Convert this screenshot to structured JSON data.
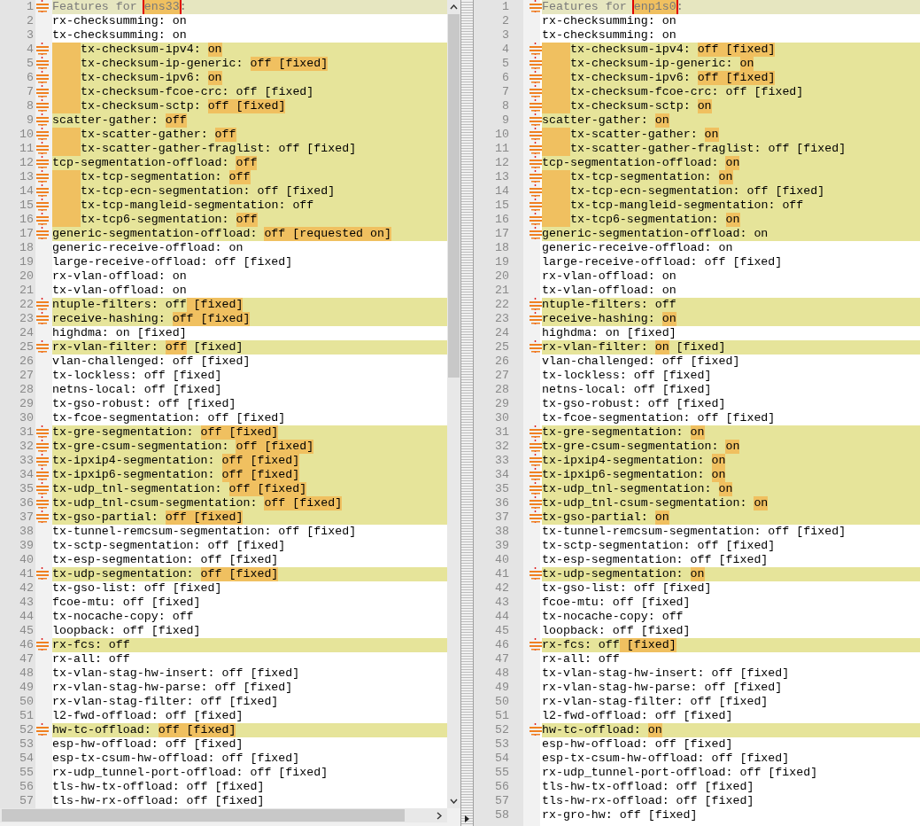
{
  "panes": [
    {
      "lines": [
        {
          "n": "1",
          "changed": true,
          "current": true,
          "indent": false,
          "parts": [
            {
              "text": "Features for ",
              "diff": false
            },
            {
              "text": "ens33",
              "diff": true,
              "boxed": true
            },
            {
              "text": ":",
              "diff": false
            }
          ]
        },
        {
          "n": "2",
          "changed": false,
          "current": false,
          "indent": false,
          "parts": [
            {
              "text": "rx-checksumming: on",
              "diff": false
            }
          ]
        },
        {
          "n": "3",
          "changed": false,
          "current": false,
          "indent": false,
          "parts": [
            {
              "text": "tx-checksumming: on",
              "diff": false
            }
          ]
        },
        {
          "n": "4",
          "changed": true,
          "current": false,
          "indent": true,
          "parts": [
            {
              "text": "tx-checksum-ipv4: ",
              "diff": false
            },
            {
              "text": "on",
              "diff": true
            }
          ]
        },
        {
          "n": "5",
          "changed": true,
          "current": false,
          "indent": true,
          "parts": [
            {
              "text": "tx-checksum-ip-generic: ",
              "diff": false
            },
            {
              "text": "off [fixed]",
              "diff": true
            }
          ]
        },
        {
          "n": "6",
          "changed": true,
          "current": false,
          "indent": true,
          "parts": [
            {
              "text": "tx-checksum-ipv6: ",
              "diff": false
            },
            {
              "text": "on",
              "diff": true
            }
          ]
        },
        {
          "n": "7",
          "changed": true,
          "current": false,
          "indent": true,
          "parts": [
            {
              "text": "tx-checksum-fcoe-crc: off [fixed]",
              "diff": false
            }
          ]
        },
        {
          "n": "8",
          "changed": true,
          "current": false,
          "indent": true,
          "parts": [
            {
              "text": "tx-checksum-sctp: ",
              "diff": false
            },
            {
              "text": "off [fixed]",
              "diff": true
            }
          ]
        },
        {
          "n": "9",
          "changed": true,
          "current": false,
          "indent": false,
          "parts": [
            {
              "text": "scatter-gather: ",
              "diff": false
            },
            {
              "text": "off",
              "diff": true
            }
          ]
        },
        {
          "n": "10",
          "changed": true,
          "current": false,
          "indent": true,
          "parts": [
            {
              "text": "tx-scatter-gather: ",
              "diff": false
            },
            {
              "text": "off",
              "diff": true
            }
          ]
        },
        {
          "n": "11",
          "changed": true,
          "current": false,
          "indent": true,
          "parts": [
            {
              "text": "tx-scatter-gather-fraglist: off [fixed]",
              "diff": false
            }
          ]
        },
        {
          "n": "12",
          "changed": true,
          "current": false,
          "indent": false,
          "parts": [
            {
              "text": "tcp-segmentation-offload: ",
              "diff": false
            },
            {
              "text": "off",
              "diff": true
            }
          ]
        },
        {
          "n": "13",
          "changed": true,
          "current": false,
          "indent": true,
          "parts": [
            {
              "text": "tx-tcp-segmentation: ",
              "diff": false
            },
            {
              "text": "off",
              "diff": true
            }
          ]
        },
        {
          "n": "14",
          "changed": true,
          "current": false,
          "indent": true,
          "parts": [
            {
              "text": "tx-tcp-ecn-segmentation: off [fixed]",
              "diff": false
            }
          ]
        },
        {
          "n": "15",
          "changed": true,
          "current": false,
          "indent": true,
          "parts": [
            {
              "text": "tx-tcp-mangleid-segmentation: off",
              "diff": false
            }
          ]
        },
        {
          "n": "16",
          "changed": true,
          "current": false,
          "indent": true,
          "parts": [
            {
              "text": "tx-tcp6-segmentation: ",
              "diff": false
            },
            {
              "text": "off",
              "diff": true
            }
          ]
        },
        {
          "n": "17",
          "changed": true,
          "current": false,
          "indent": false,
          "parts": [
            {
              "text": "generic-segmentation-offload: ",
              "diff": false
            },
            {
              "text": "off [requested on]",
              "diff": true
            }
          ]
        },
        {
          "n": "18",
          "changed": false,
          "current": false,
          "indent": false,
          "parts": [
            {
              "text": "generic-receive-offload: on",
              "diff": false
            }
          ]
        },
        {
          "n": "19",
          "changed": false,
          "current": false,
          "indent": false,
          "parts": [
            {
              "text": "large-receive-offload: off [fixed]",
              "diff": false
            }
          ]
        },
        {
          "n": "20",
          "changed": false,
          "current": false,
          "indent": false,
          "parts": [
            {
              "text": "rx-vlan-offload: on",
              "diff": false
            }
          ]
        },
        {
          "n": "21",
          "changed": false,
          "current": false,
          "indent": false,
          "parts": [
            {
              "text": "tx-vlan-offload: on",
              "diff": false
            }
          ]
        },
        {
          "n": "22",
          "changed": true,
          "current": false,
          "indent": false,
          "parts": [
            {
              "text": "ntuple-filters: off",
              "diff": false
            },
            {
              "text": " [fixed]",
              "diff": true
            }
          ]
        },
        {
          "n": "23",
          "changed": true,
          "current": false,
          "indent": false,
          "parts": [
            {
              "text": "receive-hashing: ",
              "diff": false
            },
            {
              "text": "off [fixed]",
              "diff": true
            }
          ]
        },
        {
          "n": "24",
          "changed": false,
          "current": false,
          "indent": false,
          "parts": [
            {
              "text": "highdma: on [fixed]",
              "diff": false
            }
          ]
        },
        {
          "n": "25",
          "changed": true,
          "current": false,
          "indent": false,
          "parts": [
            {
              "text": "rx-vlan-filter: ",
              "diff": false
            },
            {
              "text": "off",
              "diff": true
            },
            {
              "text": " [fixed]",
              "diff": false
            }
          ]
        },
        {
          "n": "26",
          "changed": false,
          "current": false,
          "indent": false,
          "parts": [
            {
              "text": "vlan-challenged: off [fixed]",
              "diff": false
            }
          ]
        },
        {
          "n": "27",
          "changed": false,
          "current": false,
          "indent": false,
          "parts": [
            {
              "text": "tx-lockless: off [fixed]",
              "diff": false
            }
          ]
        },
        {
          "n": "28",
          "changed": false,
          "current": false,
          "indent": false,
          "parts": [
            {
              "text": "netns-local: off [fixed]",
              "diff": false
            }
          ]
        },
        {
          "n": "29",
          "changed": false,
          "current": false,
          "indent": false,
          "parts": [
            {
              "text": "tx-gso-robust: off [fixed]",
              "diff": false
            }
          ]
        },
        {
          "n": "30",
          "changed": false,
          "current": false,
          "indent": false,
          "parts": [
            {
              "text": "tx-fcoe-segmentation: off [fixed]",
              "diff": false
            }
          ]
        },
        {
          "n": "31",
          "changed": true,
          "current": false,
          "indent": false,
          "parts": [
            {
              "text": "tx-gre-segmentation: ",
              "diff": false
            },
            {
              "text": "off [fixed]",
              "diff": true
            }
          ]
        },
        {
          "n": "32",
          "changed": true,
          "current": false,
          "indent": false,
          "parts": [
            {
              "text": "tx-gre-csum-segmentation: ",
              "diff": false
            },
            {
              "text": "off [fixed]",
              "diff": true
            }
          ]
        },
        {
          "n": "33",
          "changed": true,
          "current": false,
          "indent": false,
          "parts": [
            {
              "text": "tx-ipxip4-segmentation: ",
              "diff": false
            },
            {
              "text": "off [fixed]",
              "diff": true
            }
          ]
        },
        {
          "n": "34",
          "changed": true,
          "current": false,
          "indent": false,
          "parts": [
            {
              "text": "tx-ipxip6-segmentation: ",
              "diff": false
            },
            {
              "text": "off [fixed]",
              "diff": true
            }
          ]
        },
        {
          "n": "35",
          "changed": true,
          "current": false,
          "indent": false,
          "parts": [
            {
              "text": "tx-udp_tnl-segmentation: ",
              "diff": false
            },
            {
              "text": "off [fixed]",
              "diff": true
            }
          ]
        },
        {
          "n": "36",
          "changed": true,
          "current": false,
          "indent": false,
          "parts": [
            {
              "text": "tx-udp_tnl-csum-segmentation: ",
              "diff": false
            },
            {
              "text": "off [fixed]",
              "diff": true
            }
          ]
        },
        {
          "n": "37",
          "changed": true,
          "current": false,
          "indent": false,
          "parts": [
            {
              "text": "tx-gso-partial: ",
              "diff": false
            },
            {
              "text": "off [fixed]",
              "diff": true
            }
          ]
        },
        {
          "n": "38",
          "changed": false,
          "current": false,
          "indent": false,
          "parts": [
            {
              "text": "tx-tunnel-remcsum-segmentation: off [fixed]",
              "diff": false
            }
          ]
        },
        {
          "n": "39",
          "changed": false,
          "current": false,
          "indent": false,
          "parts": [
            {
              "text": "tx-sctp-segmentation: off [fixed]",
              "diff": false
            }
          ]
        },
        {
          "n": "40",
          "changed": false,
          "current": false,
          "indent": false,
          "parts": [
            {
              "text": "tx-esp-segmentation: off [fixed]",
              "diff": false
            }
          ]
        },
        {
          "n": "41",
          "changed": true,
          "current": false,
          "indent": false,
          "parts": [
            {
              "text": "tx-udp-segmentation: ",
              "diff": false
            },
            {
              "text": "off [fixed]",
              "diff": true
            }
          ]
        },
        {
          "n": "42",
          "changed": false,
          "current": false,
          "indent": false,
          "parts": [
            {
              "text": "tx-gso-list: off [fixed]",
              "diff": false
            }
          ]
        },
        {
          "n": "43",
          "changed": false,
          "current": false,
          "indent": false,
          "parts": [
            {
              "text": "fcoe-mtu: off [fixed]",
              "diff": false
            }
          ]
        },
        {
          "n": "44",
          "changed": false,
          "current": false,
          "indent": false,
          "parts": [
            {
              "text": "tx-nocache-copy: off",
              "diff": false
            }
          ]
        },
        {
          "n": "45",
          "changed": false,
          "current": false,
          "indent": false,
          "parts": [
            {
              "text": "loopback: off [fixed]",
              "diff": false
            }
          ]
        },
        {
          "n": "46",
          "changed": true,
          "current": false,
          "indent": false,
          "parts": [
            {
              "text": "rx-fcs: off",
              "diff": false
            }
          ]
        },
        {
          "n": "47",
          "changed": false,
          "current": false,
          "indent": false,
          "parts": [
            {
              "text": "rx-all: off",
              "diff": false
            }
          ]
        },
        {
          "n": "48",
          "changed": false,
          "current": false,
          "indent": false,
          "parts": [
            {
              "text": "tx-vlan-stag-hw-insert: off [fixed]",
              "diff": false
            }
          ]
        },
        {
          "n": "49",
          "changed": false,
          "current": false,
          "indent": false,
          "parts": [
            {
              "text": "rx-vlan-stag-hw-parse: off [fixed]",
              "diff": false
            }
          ]
        },
        {
          "n": "50",
          "changed": false,
          "current": false,
          "indent": false,
          "parts": [
            {
              "text": "rx-vlan-stag-filter: off [fixed]",
              "diff": false
            }
          ]
        },
        {
          "n": "51",
          "changed": false,
          "current": false,
          "indent": false,
          "parts": [
            {
              "text": "l2-fwd-offload: off [fixed]",
              "diff": false
            }
          ]
        },
        {
          "n": "52",
          "changed": true,
          "current": false,
          "indent": false,
          "parts": [
            {
              "text": "hw-tc-offload: ",
              "diff": false
            },
            {
              "text": "off [fixed]",
              "diff": true
            }
          ]
        },
        {
          "n": "53",
          "changed": false,
          "current": false,
          "indent": false,
          "parts": [
            {
              "text": "esp-hw-offload: off [fixed]",
              "diff": false
            }
          ]
        },
        {
          "n": "54",
          "changed": false,
          "current": false,
          "indent": false,
          "parts": [
            {
              "text": "esp-tx-csum-hw-offload: off [fixed]",
              "diff": false
            }
          ]
        },
        {
          "n": "55",
          "changed": false,
          "current": false,
          "indent": false,
          "parts": [
            {
              "text": "rx-udp_tunnel-port-offload: off [fixed]",
              "diff": false
            }
          ]
        },
        {
          "n": "56",
          "changed": false,
          "current": false,
          "indent": false,
          "parts": [
            {
              "text": "tls-hw-tx-offload: off [fixed]",
              "diff": false
            }
          ]
        },
        {
          "n": "57",
          "changed": false,
          "current": false,
          "indent": false,
          "parts": [
            {
              "text": "tls-hw-rx-offload: off [fixed]",
              "diff": false
            }
          ]
        }
      ]
    },
    {
      "lines": [
        {
          "n": "1",
          "changed": true,
          "current": true,
          "indent": false,
          "parts": [
            {
              "text": "Features for ",
              "diff": false
            },
            {
              "text": "enp1s0",
              "diff": true,
              "boxed": true
            },
            {
              "text": ":",
              "diff": false
            }
          ]
        },
        {
          "n": "2",
          "changed": false,
          "current": false,
          "indent": false,
          "parts": [
            {
              "text": "rx-checksumming: on",
              "diff": false
            }
          ]
        },
        {
          "n": "3",
          "changed": false,
          "current": false,
          "indent": false,
          "parts": [
            {
              "text": "tx-checksumming: on",
              "diff": false
            }
          ]
        },
        {
          "n": "4",
          "changed": true,
          "current": false,
          "indent": true,
          "parts": [
            {
              "text": "tx-checksum-ipv4: ",
              "diff": false
            },
            {
              "text": "off [fixed]",
              "diff": true
            }
          ]
        },
        {
          "n": "5",
          "changed": true,
          "current": false,
          "indent": true,
          "parts": [
            {
              "text": "tx-checksum-ip-generic: ",
              "diff": false
            },
            {
              "text": "on",
              "diff": true
            }
          ]
        },
        {
          "n": "6",
          "changed": true,
          "current": false,
          "indent": true,
          "parts": [
            {
              "text": "tx-checksum-ipv6: ",
              "diff": false
            },
            {
              "text": "off [fixed]",
              "diff": true
            }
          ]
        },
        {
          "n": "7",
          "changed": true,
          "current": false,
          "indent": true,
          "parts": [
            {
              "text": "tx-checksum-fcoe-crc: off [fixed]",
              "diff": false
            }
          ]
        },
        {
          "n": "8",
          "changed": true,
          "current": false,
          "indent": true,
          "parts": [
            {
              "text": "tx-checksum-sctp: ",
              "diff": false
            },
            {
              "text": "on",
              "diff": true
            }
          ]
        },
        {
          "n": "9",
          "changed": true,
          "current": false,
          "indent": false,
          "parts": [
            {
              "text": "scatter-gather: ",
              "diff": false
            },
            {
              "text": "on",
              "diff": true
            }
          ]
        },
        {
          "n": "10",
          "changed": true,
          "current": false,
          "indent": true,
          "parts": [
            {
              "text": "tx-scatter-gather: ",
              "diff": false
            },
            {
              "text": "on",
              "diff": true
            }
          ]
        },
        {
          "n": "11",
          "changed": true,
          "current": false,
          "indent": true,
          "parts": [
            {
              "text": "tx-scatter-gather-fraglist: off [fixed]",
              "diff": false
            }
          ]
        },
        {
          "n": "12",
          "changed": true,
          "current": false,
          "indent": false,
          "parts": [
            {
              "text": "tcp-segmentation-offload: ",
              "diff": false
            },
            {
              "text": "on",
              "diff": true
            }
          ]
        },
        {
          "n": "13",
          "changed": true,
          "current": false,
          "indent": true,
          "parts": [
            {
              "text": "tx-tcp-segmentation: ",
              "diff": false
            },
            {
              "text": "on",
              "diff": true
            }
          ]
        },
        {
          "n": "14",
          "changed": true,
          "current": false,
          "indent": true,
          "parts": [
            {
              "text": "tx-tcp-ecn-segmentation: off [fixed]",
              "diff": false
            }
          ]
        },
        {
          "n": "15",
          "changed": true,
          "current": false,
          "indent": true,
          "parts": [
            {
              "text": "tx-tcp-mangleid-segmentation: off",
              "diff": false
            }
          ]
        },
        {
          "n": "16",
          "changed": true,
          "current": false,
          "indent": true,
          "parts": [
            {
              "text": "tx-tcp6-segmentation: ",
              "diff": false
            },
            {
              "text": "on",
              "diff": true
            }
          ]
        },
        {
          "n": "17",
          "changed": true,
          "current": false,
          "indent": false,
          "parts": [
            {
              "text": "generic-segmentation-offload: on",
              "diff": false
            }
          ]
        },
        {
          "n": "18",
          "changed": false,
          "current": false,
          "indent": false,
          "parts": [
            {
              "text": "generic-receive-offload: on",
              "diff": false
            }
          ]
        },
        {
          "n": "19",
          "changed": false,
          "current": false,
          "indent": false,
          "parts": [
            {
              "text": "large-receive-offload: off [fixed]",
              "diff": false
            }
          ]
        },
        {
          "n": "20",
          "changed": false,
          "current": false,
          "indent": false,
          "parts": [
            {
              "text": "rx-vlan-offload: on",
              "diff": false
            }
          ]
        },
        {
          "n": "21",
          "changed": false,
          "current": false,
          "indent": false,
          "parts": [
            {
              "text": "tx-vlan-offload: on",
              "diff": false
            }
          ]
        },
        {
          "n": "22",
          "changed": true,
          "current": false,
          "indent": false,
          "parts": [
            {
              "text": "ntuple-filters: off",
              "diff": false
            }
          ]
        },
        {
          "n": "23",
          "changed": true,
          "current": false,
          "indent": false,
          "parts": [
            {
              "text": "receive-hashing: ",
              "diff": false
            },
            {
              "text": "on",
              "diff": true
            }
          ]
        },
        {
          "n": "24",
          "changed": false,
          "current": false,
          "indent": false,
          "parts": [
            {
              "text": "highdma: on [fixed]",
              "diff": false
            }
          ]
        },
        {
          "n": "25",
          "changed": true,
          "current": false,
          "indent": false,
          "parts": [
            {
              "text": "rx-vlan-filter: ",
              "diff": false
            },
            {
              "text": "on",
              "diff": true
            },
            {
              "text": " [fixed]",
              "diff": false
            }
          ]
        },
        {
          "n": "26",
          "changed": false,
          "current": false,
          "indent": false,
          "parts": [
            {
              "text": "vlan-challenged: off [fixed]",
              "diff": false
            }
          ]
        },
        {
          "n": "27",
          "changed": false,
          "current": false,
          "indent": false,
          "parts": [
            {
              "text": "tx-lockless: off [fixed]",
              "diff": false
            }
          ]
        },
        {
          "n": "28",
          "changed": false,
          "current": false,
          "indent": false,
          "parts": [
            {
              "text": "netns-local: off [fixed]",
              "diff": false
            }
          ]
        },
        {
          "n": "29",
          "changed": false,
          "current": false,
          "indent": false,
          "parts": [
            {
              "text": "tx-gso-robust: off [fixed]",
              "diff": false
            }
          ]
        },
        {
          "n": "30",
          "changed": false,
          "current": false,
          "indent": false,
          "parts": [
            {
              "text": "tx-fcoe-segmentation: off [fixed]",
              "diff": false
            }
          ]
        },
        {
          "n": "31",
          "changed": true,
          "current": false,
          "indent": false,
          "parts": [
            {
              "text": "tx-gre-segmentation: ",
              "diff": false
            },
            {
              "text": "on",
              "diff": true
            }
          ]
        },
        {
          "n": "32",
          "changed": true,
          "current": false,
          "indent": false,
          "parts": [
            {
              "text": "tx-gre-csum-segmentation: ",
              "diff": false
            },
            {
              "text": "on",
              "diff": true
            }
          ]
        },
        {
          "n": "33",
          "changed": true,
          "current": false,
          "indent": false,
          "parts": [
            {
              "text": "tx-ipxip4-segmentation: ",
              "diff": false
            },
            {
              "text": "on",
              "diff": true
            }
          ]
        },
        {
          "n": "34",
          "changed": true,
          "current": false,
          "indent": false,
          "parts": [
            {
              "text": "tx-ipxip6-segmentation: ",
              "diff": false
            },
            {
              "text": "on",
              "diff": true
            }
          ]
        },
        {
          "n": "35",
          "changed": true,
          "current": false,
          "indent": false,
          "parts": [
            {
              "text": "tx-udp_tnl-segmentation: ",
              "diff": false
            },
            {
              "text": "on",
              "diff": true
            }
          ]
        },
        {
          "n": "36",
          "changed": true,
          "current": false,
          "indent": false,
          "parts": [
            {
              "text": "tx-udp_tnl-csum-segmentation: ",
              "diff": false
            },
            {
              "text": "on",
              "diff": true
            }
          ]
        },
        {
          "n": "37",
          "changed": true,
          "current": false,
          "indent": false,
          "parts": [
            {
              "text": "tx-gso-partial: ",
              "diff": false
            },
            {
              "text": "on",
              "diff": true
            }
          ]
        },
        {
          "n": "38",
          "changed": false,
          "current": false,
          "indent": false,
          "parts": [
            {
              "text": "tx-tunnel-remcsum-segmentation: off [fixed]",
              "diff": false
            }
          ]
        },
        {
          "n": "39",
          "changed": false,
          "current": false,
          "indent": false,
          "parts": [
            {
              "text": "tx-sctp-segmentation: off [fixed]",
              "diff": false
            }
          ]
        },
        {
          "n": "40",
          "changed": false,
          "current": false,
          "indent": false,
          "parts": [
            {
              "text": "tx-esp-segmentation: off [fixed]",
              "diff": false
            }
          ]
        },
        {
          "n": "41",
          "changed": true,
          "current": false,
          "indent": false,
          "parts": [
            {
              "text": "tx-udp-segmentation: ",
              "diff": false
            },
            {
              "text": "on",
              "diff": true
            }
          ]
        },
        {
          "n": "42",
          "changed": false,
          "current": false,
          "indent": false,
          "parts": [
            {
              "text": "tx-gso-list: off [fixed]",
              "diff": false
            }
          ]
        },
        {
          "n": "43",
          "changed": false,
          "current": false,
          "indent": false,
          "parts": [
            {
              "text": "fcoe-mtu: off [fixed]",
              "diff": false
            }
          ]
        },
        {
          "n": "44",
          "changed": false,
          "current": false,
          "indent": false,
          "parts": [
            {
              "text": "tx-nocache-copy: off",
              "diff": false
            }
          ]
        },
        {
          "n": "45",
          "changed": false,
          "current": false,
          "indent": false,
          "parts": [
            {
              "text": "loopback: off [fixed]",
              "diff": false
            }
          ]
        },
        {
          "n": "46",
          "changed": true,
          "current": false,
          "indent": false,
          "parts": [
            {
              "text": "rx-fcs: off",
              "diff": false
            },
            {
              "text": " [fixed]",
              "diff": true
            }
          ]
        },
        {
          "n": "47",
          "changed": false,
          "current": false,
          "indent": false,
          "parts": [
            {
              "text": "rx-all: off",
              "diff": false
            }
          ]
        },
        {
          "n": "48",
          "changed": false,
          "current": false,
          "indent": false,
          "parts": [
            {
              "text": "tx-vlan-stag-hw-insert: off [fixed]",
              "diff": false
            }
          ]
        },
        {
          "n": "49",
          "changed": false,
          "current": false,
          "indent": false,
          "parts": [
            {
              "text": "rx-vlan-stag-hw-parse: off [fixed]",
              "diff": false
            }
          ]
        },
        {
          "n": "50",
          "changed": false,
          "current": false,
          "indent": false,
          "parts": [
            {
              "text": "rx-vlan-stag-filter: off [fixed]",
              "diff": false
            }
          ]
        },
        {
          "n": "51",
          "changed": false,
          "current": false,
          "indent": false,
          "parts": [
            {
              "text": "l2-fwd-offload: off [fixed]",
              "diff": false
            }
          ]
        },
        {
          "n": "52",
          "changed": true,
          "current": false,
          "indent": false,
          "parts": [
            {
              "text": "hw-tc-offload: ",
              "diff": false
            },
            {
              "text": "on",
              "diff": true
            }
          ]
        },
        {
          "n": "53",
          "changed": false,
          "current": false,
          "indent": false,
          "parts": [
            {
              "text": "esp-hw-offload: off [fixed]",
              "diff": false
            }
          ]
        },
        {
          "n": "54",
          "changed": false,
          "current": false,
          "indent": false,
          "parts": [
            {
              "text": "esp-tx-csum-hw-offload: off [fixed]",
              "diff": false
            }
          ]
        },
        {
          "n": "55",
          "changed": false,
          "current": false,
          "indent": false,
          "parts": [
            {
              "text": "rx-udp_tunnel-port-offload: off [fixed]",
              "diff": false
            }
          ]
        },
        {
          "n": "56",
          "changed": false,
          "current": false,
          "indent": false,
          "parts": [
            {
              "text": "tls-hw-tx-offload: off [fixed]",
              "diff": false
            }
          ]
        },
        {
          "n": "57",
          "changed": false,
          "current": false,
          "indent": false,
          "parts": [
            {
              "text": "tls-hw-rx-offload: off [fixed]",
              "diff": false
            }
          ]
        },
        {
          "n": "58",
          "changed": false,
          "current": false,
          "indent": false,
          "parts": [
            {
              "text": "rx-gro-hw: off [fixed]",
              "diff": false
            }
          ]
        }
      ]
    }
  ]
}
